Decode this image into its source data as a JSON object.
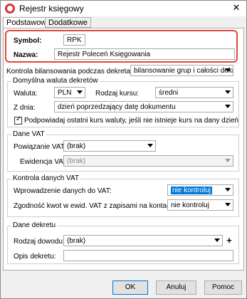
{
  "window": {
    "title": "Rejestr księgowy",
    "close_glyph": "✕"
  },
  "tabs": [
    "Podstawowe",
    "Dodatkowe"
  ],
  "symbol": {
    "label": "Symbol:",
    "value": "RPK"
  },
  "nazwa": {
    "label": "Nazwa:",
    "value": "Rejestr Poleceń Księgowania"
  },
  "kontrola_bilansowania": {
    "label": "Kontrola bilansowania podczas dekretacji:",
    "value": "bilansowanie grup i całości dekretu"
  },
  "domyslna_waluta": {
    "title": "Domyślna waluta dekretów",
    "waluta_label": "Waluta:",
    "waluta_value": "PLN",
    "rodzaj_kursu_label": "Rodzaj kursu:",
    "rodzaj_kursu_value": "średni",
    "z_dnia_label": "Z dnia:",
    "z_dnia_value": "dzień poprzedzający datę dokumentu",
    "checkbox_label": "Podpowiadaj ostatni kurs waluty, jeśli nie istnieje kurs na dany dzień"
  },
  "dane_vat": {
    "title": "Dane VAT",
    "powiazanie_label": "Powiązanie VAT:",
    "powiazanie_value": "(brak)",
    "ewidencja_label": "Ewidencja VAT:",
    "ewidencja_value": "(brak)"
  },
  "kontrola_vat": {
    "title": "Kontrola danych VAT",
    "wprowadzenie_label": "Wprowadzenie danych do VAT:",
    "wprowadzenie_value": "nie kontroluj",
    "zgodnosc_label": "Zgodność kwot w ewid. VAT z zapisami na kontach:",
    "zgodnosc_value": "nie kontroluj"
  },
  "dane_dekretu": {
    "title": "Dane dekretu",
    "rodzaj_dowodu_label": "Rodzaj dowodu:",
    "rodzaj_dowodu_value": "(brak)",
    "plus_glyph": "+",
    "opis_label": "Opis dekretu:",
    "opis_value": ""
  },
  "buttons": {
    "ok": "OK",
    "anuluj": "Anuluj",
    "pomoc": "Pomoc"
  },
  "colors": {
    "highlight_border": "#e0463c",
    "selection": "#0078d7"
  }
}
